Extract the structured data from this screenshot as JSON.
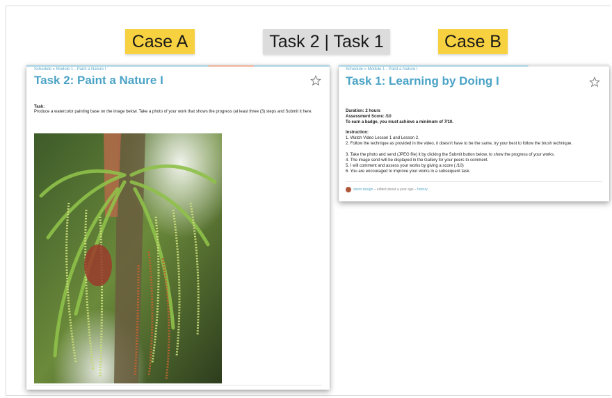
{
  "labels": {
    "case_a": "Case A",
    "center": "Task  2 | Task 1",
    "case_b": "Case B"
  },
  "card_a": {
    "breadcrumb": "Schedule » Module 1 - Paint a Nature I",
    "title": "Task 2: Paint a Nature I",
    "task_heading": "Task:",
    "task_text": "Produce a watercolor painting base on the image below. Take a photo of your work that shows the progress (at least three (3) steps and Submit it here."
  },
  "card_b": {
    "breadcrumb": "Schedule » Module 1 - Paint a Nature I",
    "title": "Task 1: Learning by Doing I",
    "duration": "Duration: 2 hours",
    "assessment": "Assessment Score:  /10",
    "badge": "To earn a badge, you must achieve a minimum of 7/10.",
    "instruction_heading": "Instruction:",
    "instructions": [
      "1. Watch Video Lesson 1 and Lesson 2.",
      "2. Follow the technique as provided in the video, it doesn't have to be the same, try your best to follow the brush technique.",
      "3. Take the photo and send (JPEG file) it by clicking the Submit button below, to show the progress of your works.",
      "4. The image send will be displayed in the Gallery for your peers to comment.",
      "5. I will comment and assess your works by giving a score (   /10)",
      "6.  You are encouraged to improve your works in a subsequent task."
    ],
    "footer_author": "shem design",
    "footer_meta": " – edited about a year ago – ",
    "footer_history": "history"
  },
  "colors": {
    "accent": "#4aa3c6",
    "label_yellow": "#f7d13f",
    "label_grey": "#dcdcdc"
  },
  "icons": {
    "star": "star-icon"
  }
}
